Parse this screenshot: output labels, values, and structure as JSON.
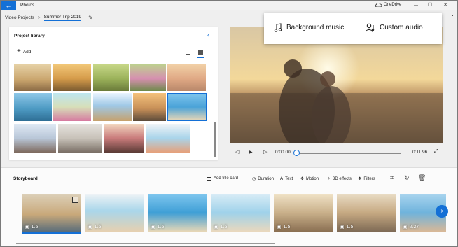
{
  "titlebar": {
    "back_glyph": "←",
    "app_title": "Photos",
    "onedrive_label": "OneDrive",
    "minimize": "—",
    "maximize": "☐",
    "close": "✕"
  },
  "breadcrumb": {
    "items": [
      "Video Projects",
      "Summer Trip 2019"
    ],
    "separator": ">",
    "more": "···"
  },
  "library": {
    "title": "Project library",
    "add_label": "Add",
    "add_glyph": "+",
    "collapse_glyph": "‹"
  },
  "audio_menu": {
    "background_music": "Background music",
    "custom_audio": "Custom audio"
  },
  "playback": {
    "current_time": "0:00.00",
    "total_time": "0:11.96",
    "progress_fraction": 0.0
  },
  "storyboard": {
    "title": "Storyboard",
    "tools": {
      "add_title_card": "Add title card",
      "duration": "Duration",
      "text": "Text",
      "motion": "Motion",
      "effects_3d": "3D effects",
      "filters": "Filters"
    },
    "more": "···",
    "clips": [
      {
        "duration": "1.5",
        "selected": true
      },
      {
        "duration": "1.5",
        "selected": false
      },
      {
        "duration": "1.5",
        "selected": false
      },
      {
        "duration": "1.5",
        "selected": false
      },
      {
        "duration": "1.5",
        "selected": false
      },
      {
        "duration": "1.5",
        "selected": false
      },
      {
        "duration": "2.27",
        "selected": false
      }
    ],
    "next_glyph": "›"
  },
  "colors": {
    "accent": "#1470d6"
  }
}
